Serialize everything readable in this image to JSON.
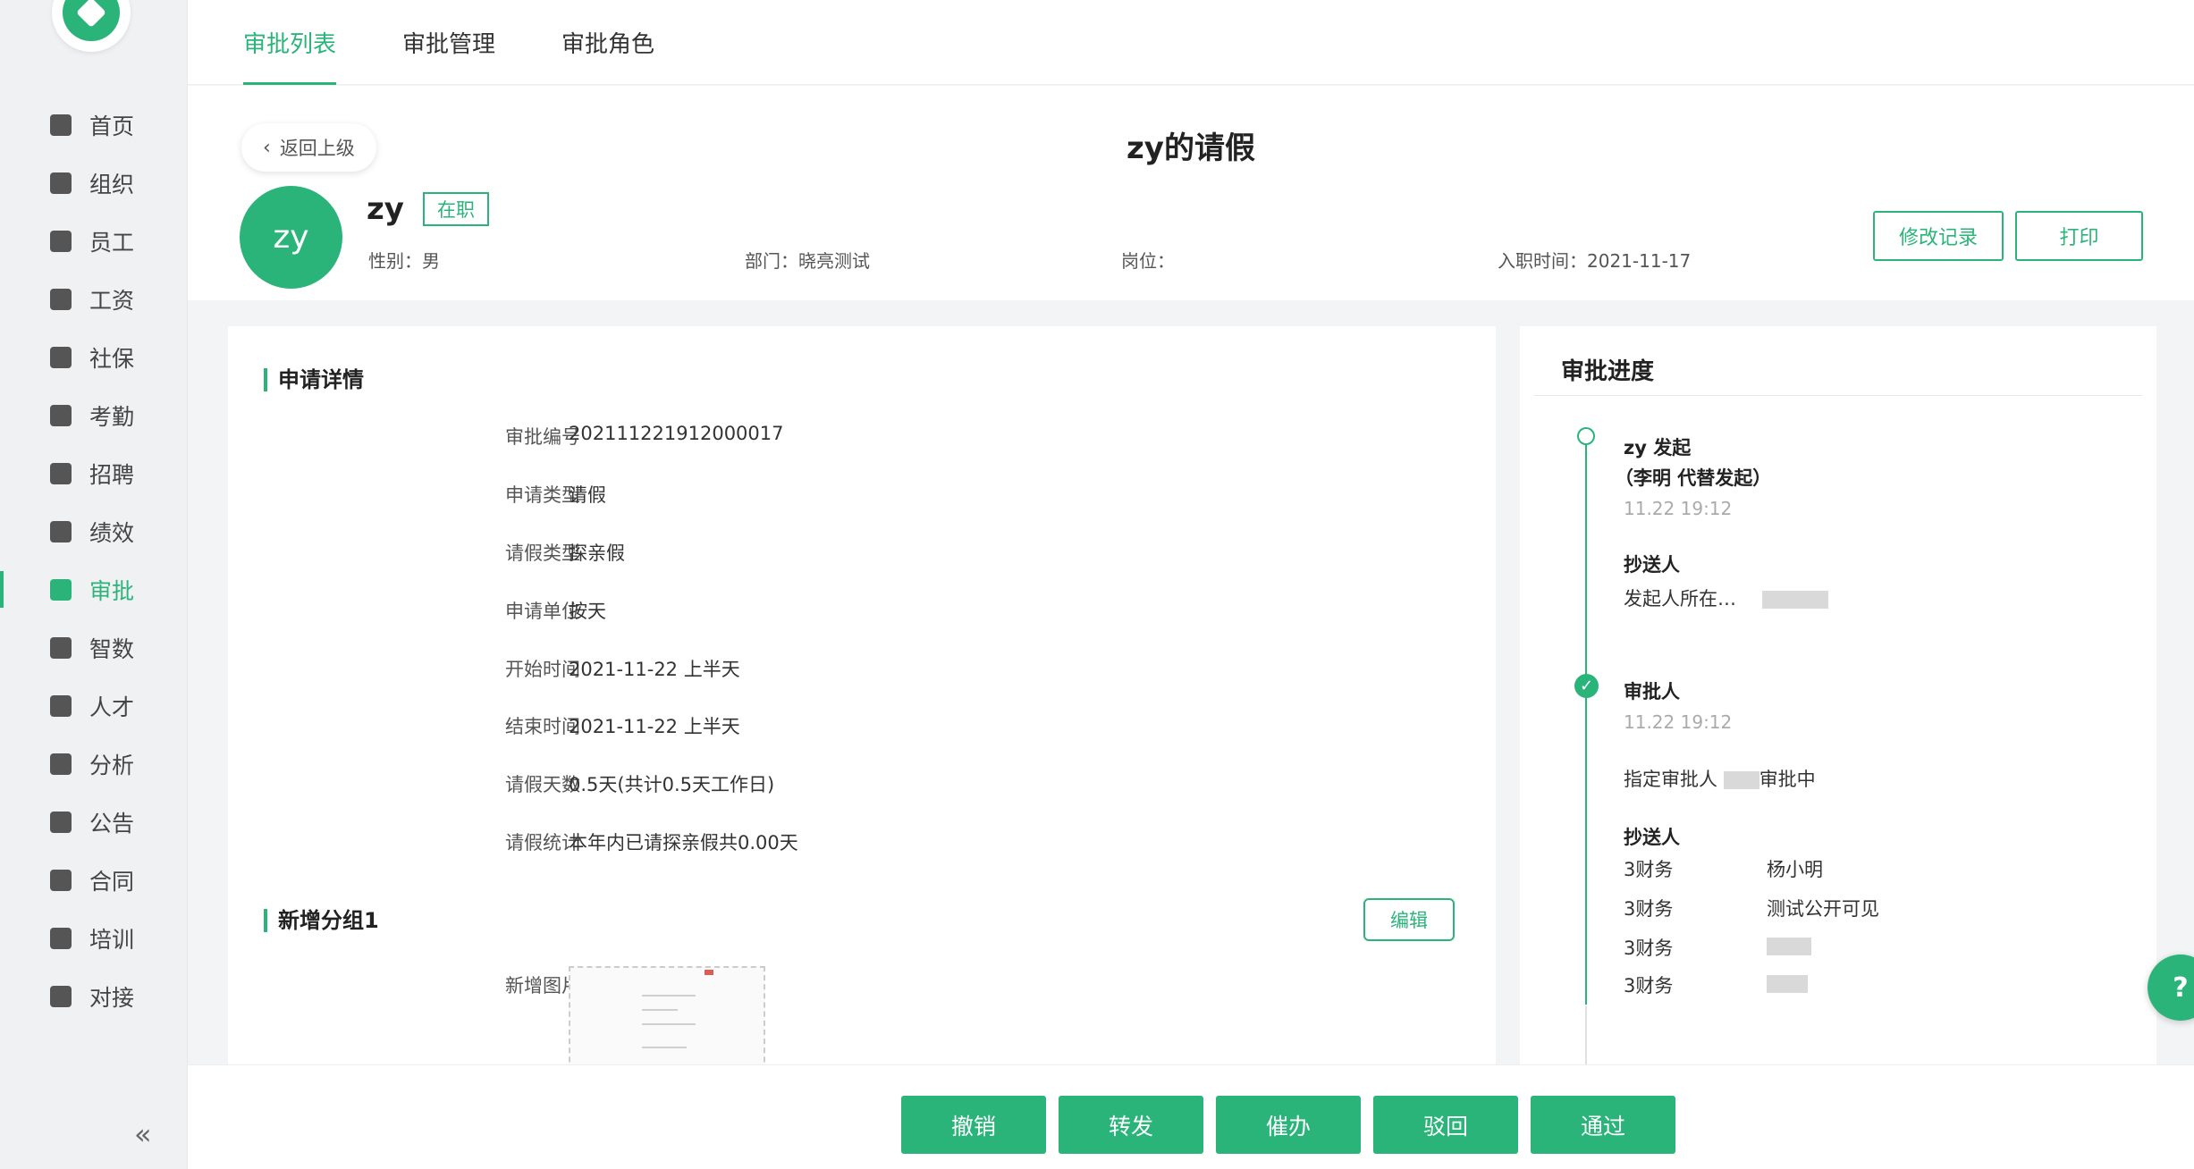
{
  "sidebar": {
    "items": [
      {
        "label": "首页",
        "icon": "home-icon"
      },
      {
        "label": "组织",
        "icon": "org-chart-icon"
      },
      {
        "label": "员工",
        "icon": "user-icon"
      },
      {
        "label": "工资",
        "icon": "building-icon"
      },
      {
        "label": "社保",
        "icon": "shield-icon"
      },
      {
        "label": "考勤",
        "icon": "calendar-icon"
      },
      {
        "label": "招聘",
        "icon": "scan-icon"
      },
      {
        "label": "绩效",
        "icon": "bar-chart-icon"
      },
      {
        "label": "审批",
        "icon": "stamp-icon"
      },
      {
        "label": "智数",
        "icon": "pie-chart-icon"
      },
      {
        "label": "人才",
        "icon": "graduation-cap-icon"
      },
      {
        "label": "分析",
        "icon": "analytics-icon"
      },
      {
        "label": "公告",
        "icon": "announcement-icon"
      },
      {
        "label": "合同",
        "icon": "contract-icon"
      },
      {
        "label": "培训",
        "icon": "training-board-icon"
      },
      {
        "label": "对接",
        "icon": "link-icon"
      }
    ],
    "active_index": 8,
    "collapse_label": "«"
  },
  "top_tabs": [
    "审批列表",
    "审批管理",
    "审批角色"
  ],
  "header": {
    "back_label": "返回上级",
    "page_title": "zy的请假",
    "avatar_text": "zy",
    "employee_name": "zy",
    "status_badge": "在职",
    "gender": "性别：男",
    "department": "部门：晓亮测试",
    "position": "岗位：",
    "hire_date": "入职时间：2021-11-17",
    "history_button": "修改记录",
    "print_button": "打印"
  },
  "details": {
    "section_title": "申请详情",
    "fields": [
      {
        "label": "审批编号",
        "value": "202111221912000017"
      },
      {
        "label": "申请类型",
        "value": "请假"
      },
      {
        "label": "请假类型",
        "value": "探亲假"
      },
      {
        "label": "申请单位",
        "value": "按天"
      },
      {
        "label": "开始时间",
        "value": "2021-11-22 上半天"
      },
      {
        "label": "结束时间",
        "value": "2021-11-22 上半天"
      },
      {
        "label": "请假天数",
        "value": "0.5天(共计0.5天工作日)"
      },
      {
        "label": "请假统计",
        "value": "本年内已请探亲假共0.00天"
      }
    ],
    "group_title": "新增分组1",
    "edit_button": "编辑",
    "image_label": "新增图片"
  },
  "progress": {
    "title": "审批进度",
    "initiator": "zy 发起",
    "proxy": "（李明 代替发起）",
    "initiated_time": "11.22 19:12",
    "cc_title_1": "抄送人",
    "cc_desc_1": "发起人所在…",
    "approver_title": "审批人",
    "approver_time": "11.22 19:12",
    "approver_prefix": "指定审批人 ",
    "approver_suffix": "审批中",
    "cc_title_2": "抄送人",
    "cc_rows": [
      {
        "dept": "3财务",
        "name": "杨小明"
      },
      {
        "dept": "3财务",
        "name": "测试公开可见"
      },
      {
        "dept": "3财务",
        "name": ""
      },
      {
        "dept": "3财务",
        "name": ""
      }
    ]
  },
  "help_label": "?",
  "actions": [
    "撤销",
    "转发",
    "催办",
    "驳回",
    "通过"
  ],
  "colors": {
    "accent": "#2bb47a"
  }
}
